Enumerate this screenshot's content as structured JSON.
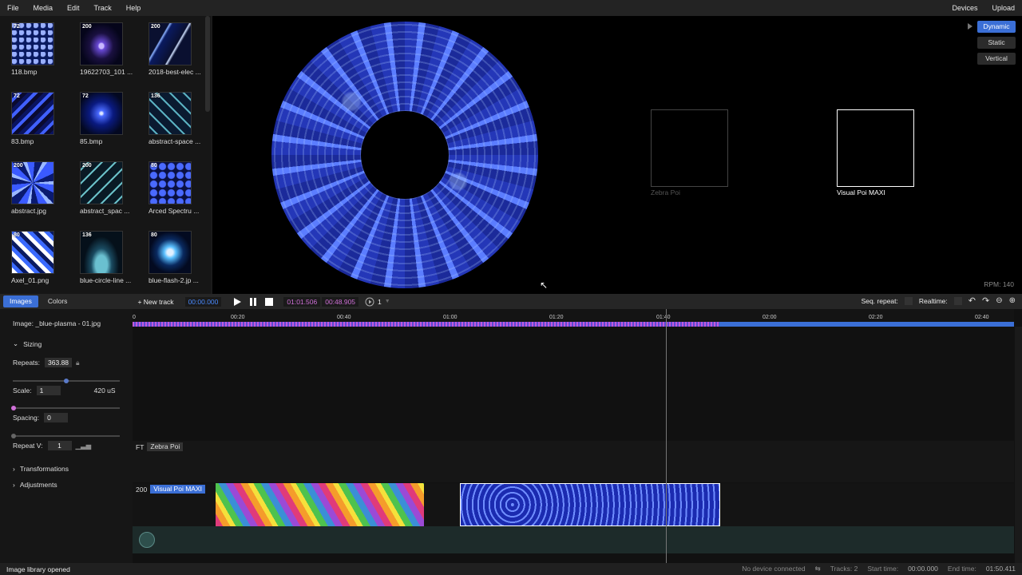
{
  "menu": {
    "items": [
      "File",
      "Media",
      "Edit",
      "Track",
      "Help"
    ],
    "right": [
      "Devices",
      "Upload"
    ]
  },
  "library": {
    "items": [
      {
        "name": "118.bmp",
        "badge": "72"
      },
      {
        "name": "19622703_101 ...",
        "badge": "200"
      },
      {
        "name": "2018-best-elec ...",
        "badge": "200"
      },
      {
        "name": "83.bmp",
        "badge": "72"
      },
      {
        "name": "85.bmp",
        "badge": "72"
      },
      {
        "name": "abstract-space ...",
        "badge": "136"
      },
      {
        "name": "abstract.jpg",
        "badge": "200"
      },
      {
        "name": "abstract_spac ...",
        "badge": "200"
      },
      {
        "name": "Arced Spectru ...",
        "badge": "80"
      },
      {
        "name": "Axel_01.png",
        "badge": "80"
      },
      {
        "name": "blue-circle-line ...",
        "badge": "136"
      },
      {
        "name": "blue-flash-2.jp ...",
        "badge": "80"
      }
    ]
  },
  "preview": {
    "devices": [
      {
        "label": "Zebra Poi",
        "active": false
      },
      {
        "label": "Visual Poi MAXI",
        "active": true
      }
    ],
    "modes": [
      "Dynamic",
      "Static",
      "Vertical"
    ],
    "active_mode": "Dynamic",
    "rpm": "RPM: 140"
  },
  "toolbar": {
    "tabs": [
      "Images",
      "Colors"
    ],
    "new_track": "New track",
    "current_time": "00:00.000",
    "sel_start": "01:01.506",
    "sel_end": "00:48.905",
    "loop_count": "1",
    "seq_repeat": "Seq. repeat:",
    "realtime": "Realtime:"
  },
  "props": {
    "image_label": "Image: _blue-plasma - 01.jpg",
    "sizing": "Sizing",
    "repeats_label": "Repeats:",
    "repeats_value": "363.88",
    "scale_label": "Scale:",
    "scale_value": "1",
    "scale_unit": "420 uS",
    "spacing_label": "Spacing:",
    "spacing_value": "0",
    "repeatv_label": "Repeat V:",
    "repeatv_value": "1",
    "transformations": "Transformations",
    "adjustments": "Adjustments"
  },
  "timeline": {
    "ticks": [
      "0",
      "00:20",
      "00:40",
      "01:00",
      "01:20",
      "01:40",
      "02:00",
      "02:20",
      "02:40"
    ],
    "tracks": [
      {
        "prefix": "FT",
        "name": "Zebra Poi"
      },
      {
        "prefix": "200",
        "name": "Visual Poi MAXI"
      }
    ]
  },
  "status": {
    "left": "Image library opened",
    "device": "No device connected",
    "tracks": "Tracks: 2",
    "start_label": "Start time:",
    "start_value": "00:00.000",
    "end_label": "End time:",
    "end_value": "01:50.411"
  },
  "colors": {
    "accent": "#3b6fd6",
    "background": "#1b1b1b",
    "preview_bg": "#000000"
  }
}
